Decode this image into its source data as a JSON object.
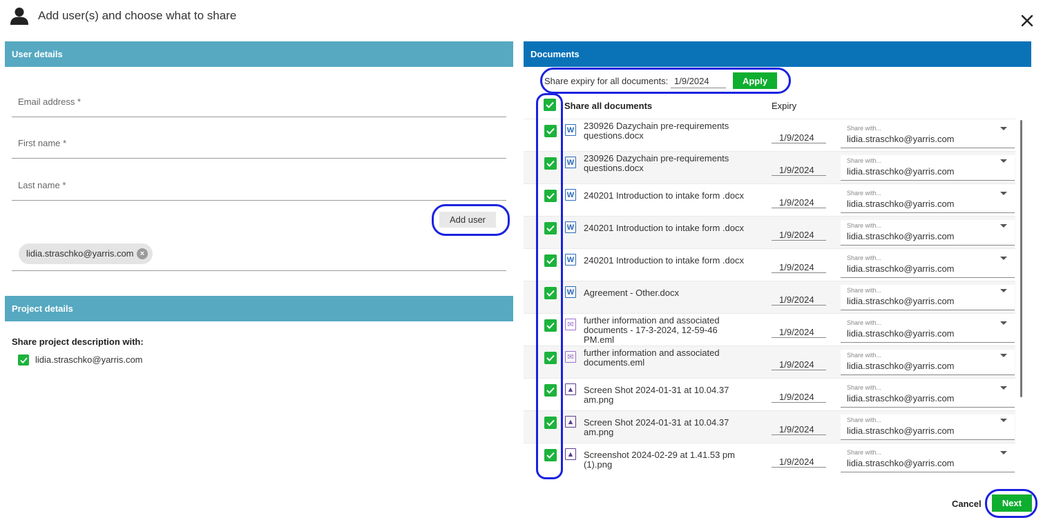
{
  "dialog": {
    "title": "Add user(s) and choose what to share",
    "close_icon": "close-icon",
    "user_icon": "user-icon"
  },
  "user_details": {
    "heading": "User details",
    "email_label": "Email address *",
    "first_name_label": "First name *",
    "last_name_label": "Last name *",
    "add_user_label": "Add user",
    "added_users": [
      "lidia.straschko@yarris.com"
    ]
  },
  "project_details": {
    "heading": "Project details",
    "share_label": "Share project description with:",
    "shared_users": [
      {
        "email": "lidia.straschko@yarris.com",
        "checked": true
      }
    ]
  },
  "documents": {
    "heading": "Documents",
    "expiry_all_label": "Share expiry for all documents:",
    "expiry_all_value": "1/9/2024",
    "apply_label": "Apply",
    "share_all_label": "Share all documents",
    "share_all_checked": true,
    "expiry_col_label": "Expiry",
    "share_with_placeholder": "Share with...",
    "items": [
      {
        "name": "230926 Dazychain pre-requirements questions.docx",
        "type": "word",
        "checked": true,
        "expiry": "1/9/2024",
        "share_with": "lidia.straschko@yarris.com"
      },
      {
        "name": "230926 Dazychain pre-requirements questions.docx",
        "type": "word",
        "checked": true,
        "expiry": "1/9/2024",
        "share_with": "lidia.straschko@yarris.com"
      },
      {
        "name": "240201 Introduction to intake form .docx",
        "type": "word",
        "checked": true,
        "expiry": "1/9/2024",
        "share_with": "lidia.straschko@yarris.com"
      },
      {
        "name": "240201 Introduction to intake form .docx",
        "type": "word",
        "checked": true,
        "expiry": "1/9/2024",
        "share_with": "lidia.straschko@yarris.com"
      },
      {
        "name": "240201 Introduction to intake form .docx",
        "type": "word",
        "checked": true,
        "expiry": "1/9/2024",
        "share_with": "lidia.straschko@yarris.com"
      },
      {
        "name": "Agreement - Other.docx",
        "type": "word",
        "checked": true,
        "expiry": "1/9/2024",
        "share_with": "lidia.straschko@yarris.com"
      },
      {
        "name": "further information and associated documents - 17-3-2024, 12-59-46 PM.eml",
        "type": "email",
        "checked": true,
        "expiry": "1/9/2024",
        "share_with": "lidia.straschko@yarris.com"
      },
      {
        "name": "further information and associated documents.eml",
        "type": "email",
        "checked": true,
        "expiry": "1/9/2024",
        "share_with": "lidia.straschko@yarris.com"
      },
      {
        "name": "Screen Shot 2024-01-31 at 10.04.37 am.png",
        "type": "image",
        "checked": true,
        "expiry": "1/9/2024",
        "share_with": "lidia.straschko@yarris.com"
      },
      {
        "name": "Screen Shot 2024-01-31 at 10.04.37 am.png",
        "type": "image",
        "checked": true,
        "expiry": "1/9/2024",
        "share_with": "lidia.straschko@yarris.com"
      },
      {
        "name": "Screenshot 2024-02-29 at 1.41.53 pm (1).png",
        "type": "image",
        "checked": true,
        "expiry": "1/9/2024",
        "share_with": "lidia.straschko@yarris.com"
      }
    ]
  },
  "footer": {
    "cancel_label": "Cancel",
    "next_label": "Next"
  },
  "colors": {
    "accent_green": "#0eae2f",
    "checkbox_green": "#1cb33c",
    "user_panel": "#56a9c1",
    "docs_panel": "#0a73b8",
    "highlight": "#1a22e0"
  }
}
